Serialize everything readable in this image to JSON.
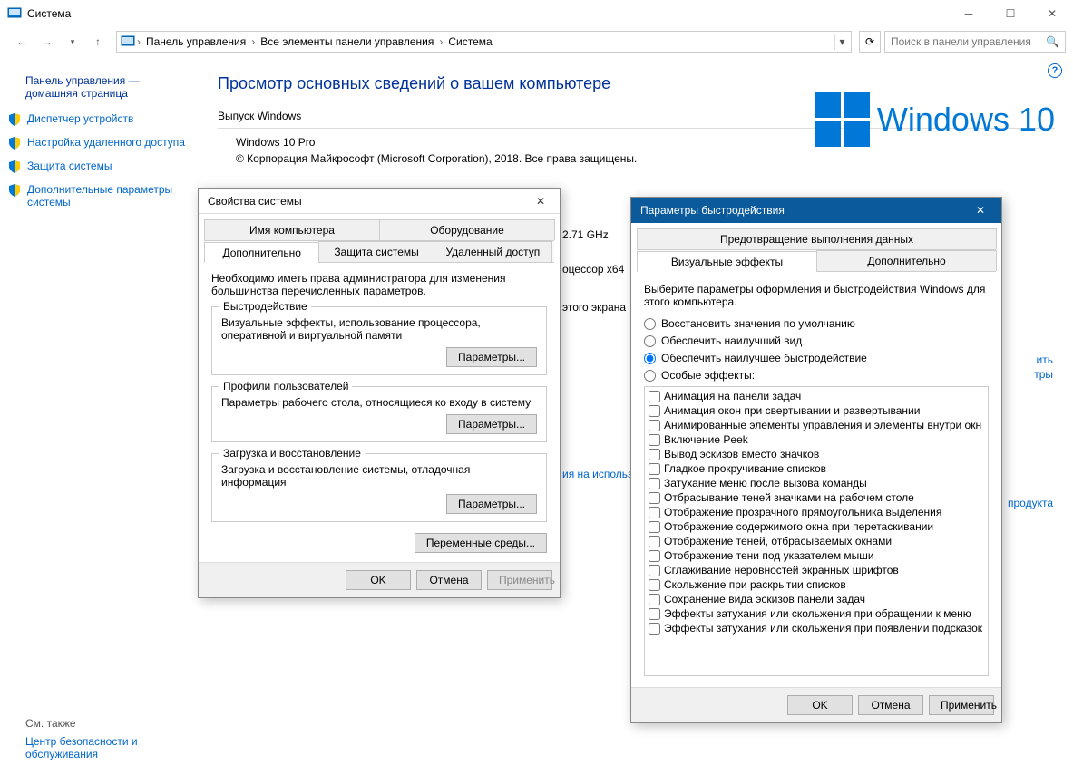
{
  "window": {
    "title": "Система",
    "search_placeholder": "Поиск в панели управления"
  },
  "breadcrumbs": {
    "b1": "Панель управления",
    "b2": "Все элементы панели управления",
    "b3": "Система"
  },
  "sidebar": {
    "head": "Панель управления — домашняя страница",
    "items": {
      "device_manager": "Диспетчер устройств",
      "remote_settings": "Настройка удаленного доступа",
      "system_protection": "Защита системы",
      "advanced_settings": "Дополнительные параметры системы"
    },
    "see_also": "См. также",
    "security": "Центр безопасности и обслуживания"
  },
  "main": {
    "heading": "Просмотр основных сведений о вашем компьютере",
    "section_edition": "Выпуск Windows",
    "edition": "Windows 10 Pro",
    "copyright": "© Корпорация Майкрософт (Microsoft Corporation), 2018. Все права защищены.",
    "logo_text": "Windows 10",
    "cpu_tail": "2.71 GHz",
    "proc_label": "оцессор x64",
    "screen_label": "этого экрана",
    "link1_tail": "ить",
    "link2_tail": "тры",
    "usage_link": "ия на использ",
    "product_link": "продукта"
  },
  "sysprops": {
    "title": "Свойства системы",
    "tabs": {
      "computer_name": "Имя компьютера",
      "hardware": "Оборудование",
      "advanced": "Дополнительно",
      "system_protection": "Защита системы",
      "remote": "Удаленный доступ"
    },
    "admin_note": "Необходимо иметь права администратора для изменения большинства перечисленных параметров.",
    "perf_group": "Быстродействие",
    "perf_desc": "Визуальные эффекты, использование процессора, оперативной и виртуальной памяти",
    "profiles_group": "Профили пользователей",
    "profiles_desc": "Параметры рабочего стола, относящиеся ко входу в систему",
    "startup_group": "Загрузка и восстановление",
    "startup_desc": "Загрузка и восстановление системы, отладочная информация",
    "params_btn": "Параметры...",
    "env_vars_btn": "Переменные среды...",
    "ok": "OK",
    "cancel": "Отмена",
    "apply": "Применить"
  },
  "perf": {
    "title": "Параметры быстродействия",
    "tabs": {
      "dep": "Предотвращение выполнения данных",
      "visual": "Визуальные эффекты",
      "advanced": "Дополнительно"
    },
    "intro": "Выберите параметры оформления и быстродействия Windows для этого компьютера.",
    "radio_default": "Восстановить значения по умолчанию",
    "radio_best_look": "Обеспечить наилучший вид",
    "radio_best_perf": "Обеспечить наилучшее быстродействие",
    "radio_custom": "Особые эффекты:",
    "checks": [
      "Анимация на панели задач",
      "Анимация окон при свертывании и развертывании",
      "Анимированные элементы управления и элементы внутри окн",
      "Включение Peek",
      "Вывод эскизов вместо значков",
      "Гладкое прокручивание списков",
      "Затухание меню после вызова команды",
      "Отбрасывание теней значками на рабочем столе",
      "Отображение прозрачного прямоугольника выделения",
      "Отображение содержимого окна при перетаскивании",
      "Отображение теней, отбрасываемых окнами",
      "Отображение тени под указателем мыши",
      "Сглаживание неровностей экранных шрифтов",
      "Скольжение при раскрытии списков",
      "Сохранение вида эскизов панели задач",
      "Эффекты затухания или скольжения при обращении к меню",
      "Эффекты затухания или скольжения при появлении подсказок"
    ],
    "ok": "OK",
    "cancel": "Отмена",
    "apply": "Применить"
  }
}
